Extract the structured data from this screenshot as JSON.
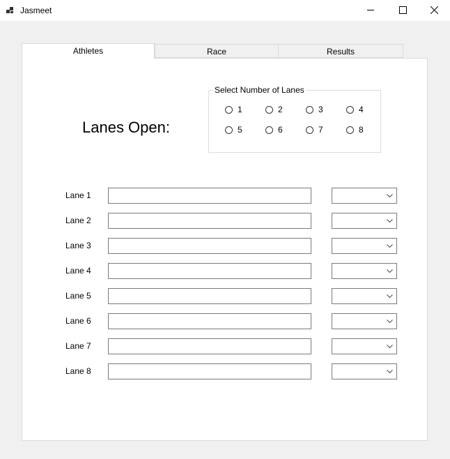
{
  "window": {
    "title": "Jasmeet"
  },
  "tabs": [
    {
      "label": "Athletes",
      "active": true
    },
    {
      "label": "Race",
      "active": false
    },
    {
      "label": "Results",
      "active": false
    }
  ],
  "athletes": {
    "lanes_open_label": "Lanes Open:",
    "lane_selector": {
      "legend": "Select Number of Lanes",
      "options": [
        "1",
        "2",
        "3",
        "4",
        "5",
        "6",
        "7",
        "8"
      ],
      "selected": null
    },
    "lanes": [
      {
        "label": "Lane 1",
        "name_value": "",
        "combo_value": ""
      },
      {
        "label": "Lane 2",
        "name_value": "",
        "combo_value": ""
      },
      {
        "label": "Lane 3",
        "name_value": "",
        "combo_value": ""
      },
      {
        "label": "Lane 4",
        "name_value": "",
        "combo_value": ""
      },
      {
        "label": "Lane 5",
        "name_value": "",
        "combo_value": ""
      },
      {
        "label": "Lane 6",
        "name_value": "",
        "combo_value": ""
      },
      {
        "label": "Lane 7",
        "name_value": "",
        "combo_value": ""
      },
      {
        "label": "Lane 8",
        "name_value": "",
        "combo_value": ""
      }
    ]
  }
}
